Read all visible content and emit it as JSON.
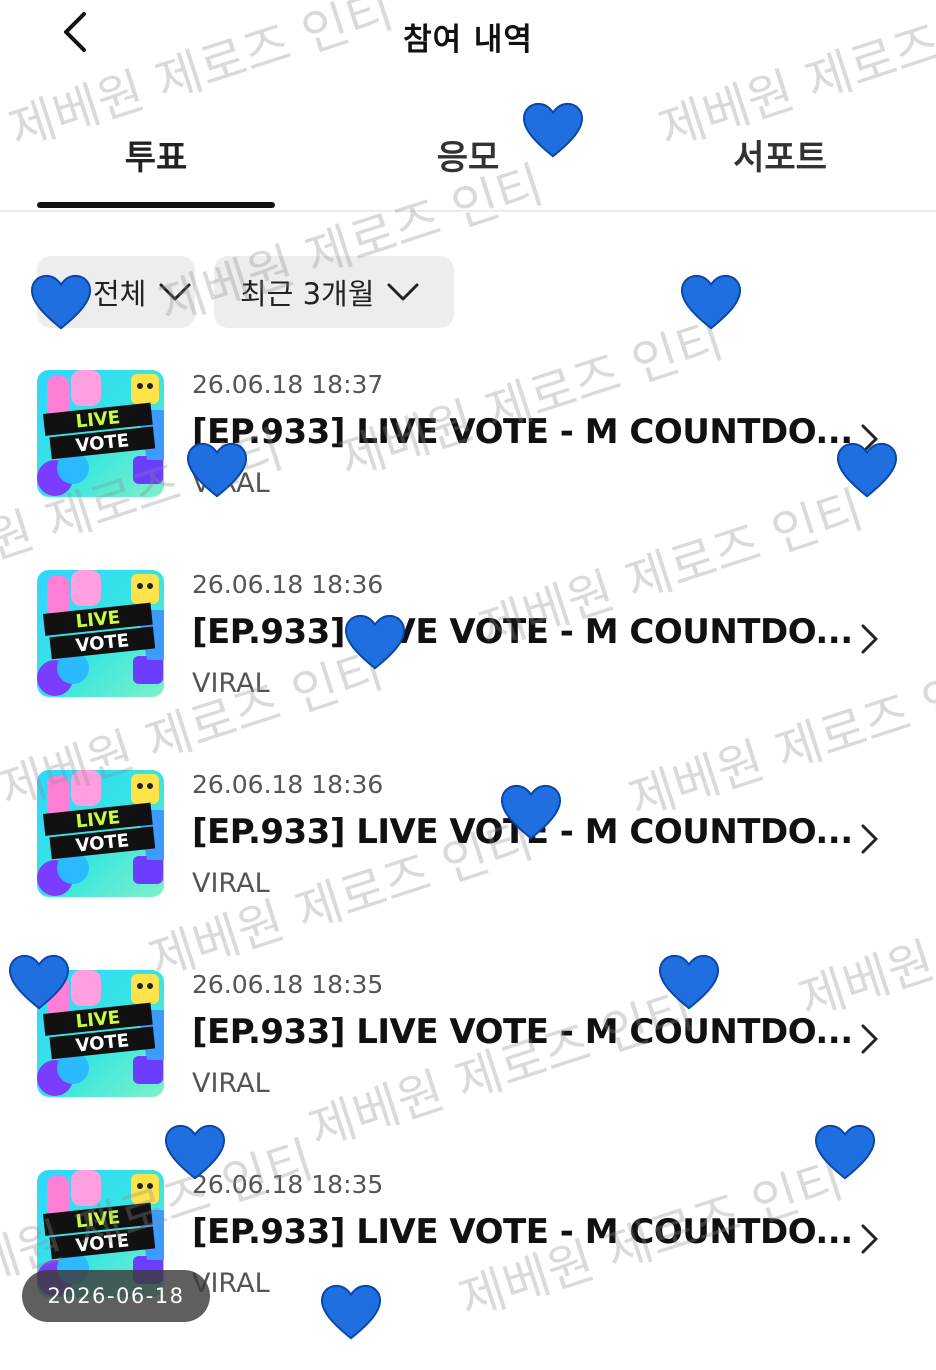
{
  "header": {
    "title": "참여 내역"
  },
  "tabs": [
    {
      "label": "투표",
      "active": true
    },
    {
      "label": "응모",
      "active": false
    },
    {
      "label": "서포트",
      "active": false
    }
  ],
  "filters": {
    "type_label": "전체",
    "period_label": "최근 3개월"
  },
  "thumbnail_text": {
    "line1": "LIVE",
    "line2": "VOTE"
  },
  "items": [
    {
      "date": "26.06.18 18:37",
      "title": "[EP.933] LIVE VOTE - M COUNTDO...",
      "source": "VIRAL"
    },
    {
      "date": "26.06.18 18:36",
      "title": "[EP.933] LIVE VOTE - M COUNTDO...",
      "source": "VIRAL"
    },
    {
      "date": "26.06.18 18:36",
      "title": "[EP.933] LIVE VOTE - M COUNTDO...",
      "source": "VIRAL"
    },
    {
      "date": "26.06.18 18:35",
      "title": "[EP.933] LIVE VOTE - M COUNTDO...",
      "source": "VIRAL"
    },
    {
      "date": "26.06.18 18:35",
      "title": "[EP.933] LIVE VOTE - M COUNTDO...",
      "source": "VIRAL"
    }
  ],
  "watermark_text": "제베원 제로즈 인티",
  "date_badge": "2026-06-18",
  "colors": {
    "heart": "#1f6fe0",
    "tab_underline": "#111111",
    "chip_bg": "#ededf0"
  },
  "icons": {
    "back": "chevron-left-icon",
    "dropdown": "chevron-down-icon",
    "row": "chevron-right-icon",
    "decor": "heart-icon"
  }
}
